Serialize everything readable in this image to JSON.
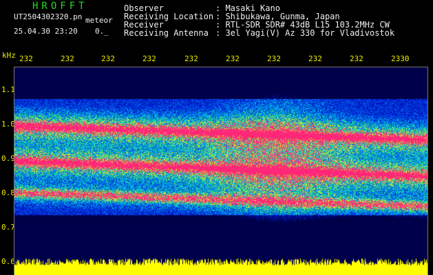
{
  "header": {
    "app_title": "HROFFT",
    "file_name": "UT2504302320.pn",
    "mode_label": "meteor",
    "date_time": "25.04.30 23:20",
    "mini_value": "0._"
  },
  "info": [
    {
      "label": "Observer",
      "value": ": Masaki Kano"
    },
    {
      "label": "Receiving Location",
      "value": ": Shibukawa, Gunma, Japan"
    },
    {
      "label": "Receiver",
      "value": ": RTL-SDR SDR# 43dB L15 103.2MHz CW"
    },
    {
      "label": "Receiving Antenna",
      "value": ": 3el Yagi(V) Az 330 for Vladivostok"
    }
  ],
  "axis": {
    "y_unit": "kHz",
    "x_ticks": [
      "232",
      "232",
      "232",
      "232",
      "232",
      "232",
      "232",
      "232",
      "232",
      "2330"
    ],
    "y_ticks": [
      "1.1",
      "1.0",
      "0.9",
      "0.8",
      "0.7",
      "0.6"
    ]
  },
  "colors": {
    "background": "#000000",
    "title": "#22dd22",
    "axis_text": "#eeee00",
    "info_text": "#f0f0f0",
    "signal_peak": "#ff3080",
    "noise_floor": "#00004a",
    "power_bar": "#ffff00"
  }
}
